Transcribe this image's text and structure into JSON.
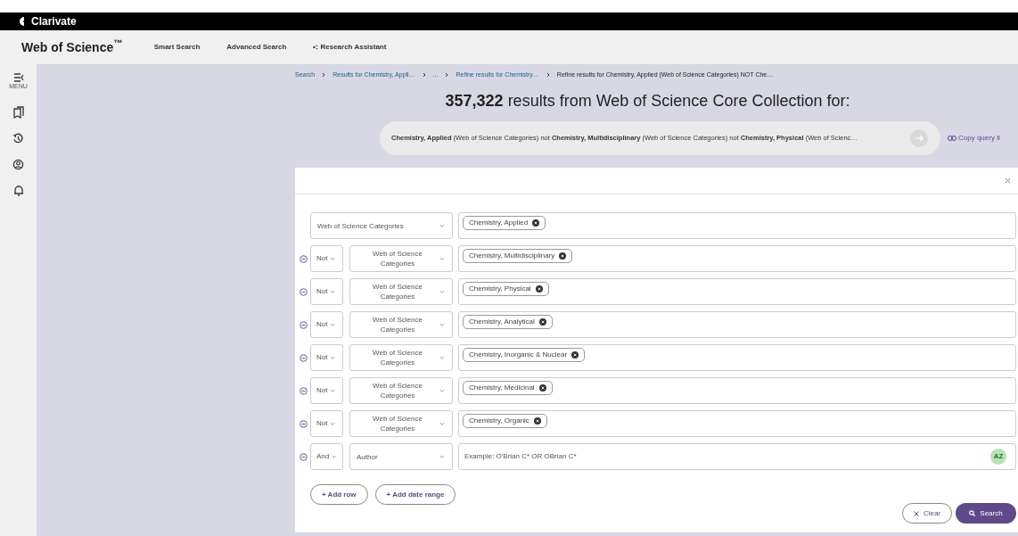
{
  "top_bar": {
    "brand": "Clarivate"
  },
  "header": {
    "logo": "Web of Science$^{™}$",
    "nav": [
      "Smart Search",
      "Advanced Search",
      "Research Assistant"
    ]
  },
  "sidebar": {
    "menu_label": "MENU"
  },
  "breadcrumb": [
    {
      "label": "Search",
      "kind": "link"
    },
    {
      "label": "Results for Chemistry, Appli…",
      "kind": "link"
    },
    {
      "label": "...",
      "kind": "link"
    },
    {
      "label": "Refine results for Chemistry…",
      "kind": "link"
    },
    {
      "label": "Refine results for Chemistry, Applied (Web of Science Categories) NOT Che…",
      "kind": "current"
    }
  ],
  "results_heading": "**357,322** results from Web of Science Core Collection for:",
  "query": {
    "text": "**Chemistry, Applied** (Web of Science Categories) not **Chemistry, Multidisciplinary** (Web of Science Categories) not **Chemistry, Physical** (Web of Scienc…",
    "copy_link": "Copy query li"
  },
  "rows": [
    {
      "field": "Web of Science Categories",
      "terms": [
        "Chemistry, Applied"
      ]
    },
    {
      "operator": "Not",
      "field": "Web of Science Categories",
      "terms": [
        "Chemistry, Multidisciplinary"
      ]
    },
    {
      "operator": "Not",
      "field": "Web of Science Categories",
      "terms": [
        "Chemistry, Physical"
      ]
    },
    {
      "operator": "Not",
      "field": "Web of Science Categories",
      "terms": [
        "Chemistry, Analytical"
      ]
    },
    {
      "operator": "Not",
      "field": "Web of Science Categories",
      "terms": [
        "Chemistry, Inorganic & Nuclear"
      ]
    },
    {
      "operator": "Not",
      "field": "Web of Science Categories",
      "terms": [
        "Chemistry, Medicinal"
      ]
    },
    {
      "operator": "Not",
      "field": "Web of Science Categories",
      "terms": [
        "Chemistry, Organic"
      ]
    },
    {
      "operator": "And",
      "field": "Author",
      "placeholder": "Example: O'Brian C* OR OBrian C*",
      "badge": "AZ"
    }
  ],
  "add_buttons": [
    "+ Add row",
    "+ Add date range"
  ],
  "actions": {
    "clear": "Clear",
    "search": "Search"
  }
}
